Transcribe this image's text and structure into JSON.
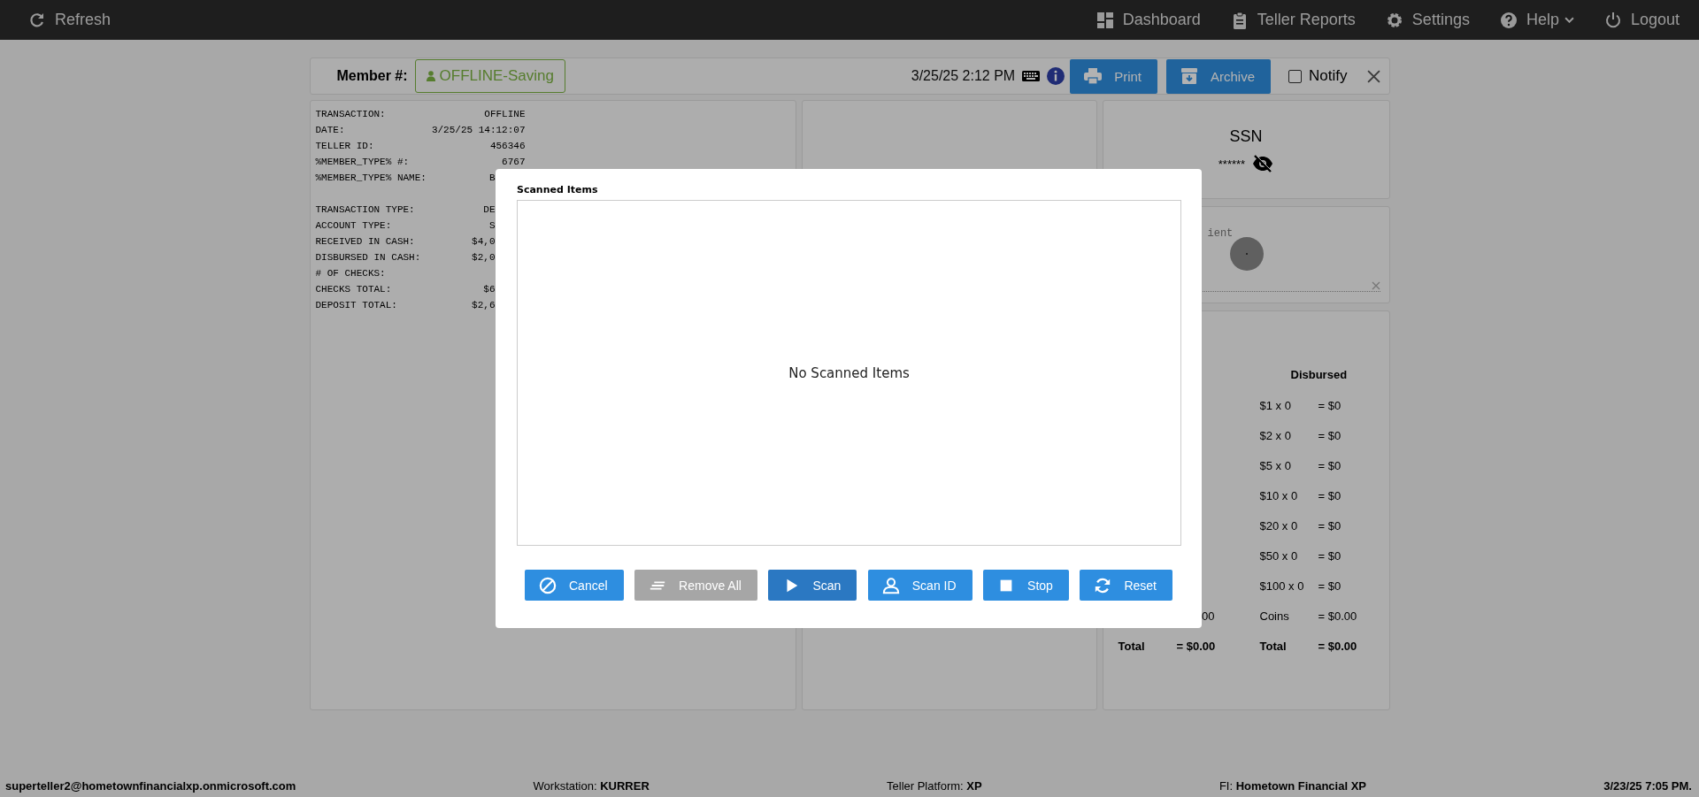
{
  "topbar": {
    "refresh": "Refresh",
    "nav": [
      {
        "label": "Dashboard",
        "dropdown": false
      },
      {
        "label": "Teller Reports",
        "dropdown": false
      },
      {
        "label": "Settings",
        "dropdown": false
      },
      {
        "label": "Help",
        "dropdown": true
      },
      {
        "label": "Logout",
        "dropdown": false
      }
    ]
  },
  "header": {
    "member_label": "Member #:",
    "member_badge": "OFFLINE-Saving",
    "datetime": "3/25/25 2:12 PM",
    "buttons": [
      "Print",
      "Archive"
    ],
    "notify": {
      "label": "Notify",
      "checked": false
    }
  },
  "receipt": {
    "sections": [
      [
        {
          "label": "TRANSACTION:",
          "value": "OFFLINE",
          "cut": false
        },
        {
          "label": "DATE:",
          "value": "3/25/25 14:12:07",
          "cut": false
        },
        {
          "label": "TELLER ID:",
          "value": "456346",
          "cut": false
        },
        {
          "label": "%MEMBER_TYPE% #:",
          "value": "6767",
          "cut": false
        },
        {
          "label": "%MEMBER_TYPE% NAME:",
          "value": "B",
          "cut": true
        }
      ],
      [
        {
          "label": "TRANSACTION TYPE:",
          "value": "DE",
          "cut": true
        },
        {
          "label": "ACCOUNT TYPE:",
          "value": "S",
          "cut": true
        },
        {
          "label": "RECEIVED IN CASH:",
          "value": "$4,0",
          "cut": true
        },
        {
          "label": "DISBURSED IN CASH:",
          "value": "$2,0",
          "cut": true
        },
        {
          "label": "# OF CHECKS:"
        },
        {
          "label": "CHECKS TOTAL:",
          "value": "$6",
          "cut": true
        },
        {
          "label": "DEPOSIT TOTAL:",
          "value": "$2,6",
          "cut": true
        }
      ]
    ]
  },
  "ssn": {
    "title": "SSN",
    "value": "******",
    "hidden": true
  },
  "signature": {
    "label": "ient"
  },
  "cash": {
    "heading": "Disbursed",
    "rows": [
      {
        "kind": "count",
        "label": "$1 x 0",
        "amount": "= $0"
      },
      {
        "kind": "count",
        "label": "$2 x 0",
        "amount": "= $0"
      },
      {
        "kind": "count",
        "label": "$5 x 0",
        "amount": "= $0"
      },
      {
        "kind": "count",
        "label": "$10 x 0",
        "amount": "= $0"
      },
      {
        "kind": "count",
        "label": "$20 x 0",
        "amount": "= $0"
      },
      {
        "kind": "count",
        "label": "$50 x 0",
        "amount": "= $0"
      },
      {
        "kind": "count",
        "label": "$100 x 0",
        "amount": "= $0"
      },
      {
        "kind": "coins",
        "left_amount": "00",
        "label": "Coins",
        "amount": "= $0.00"
      },
      {
        "kind": "total",
        "left_label": "Total",
        "left_amount": "= $0.00",
        "label": "Total",
        "amount": "= $0.00"
      }
    ]
  },
  "modal": {
    "title": "Scanned Items",
    "empty_text": "No Scanned Items",
    "buttons": [
      {
        "label": "Cancel",
        "disabled": false,
        "pressed": false
      },
      {
        "label": "Remove All",
        "disabled": true,
        "pressed": false
      },
      {
        "label": "Scan",
        "disabled": false,
        "pressed": true
      },
      {
        "label": "Scan ID",
        "disabled": false,
        "pressed": false
      },
      {
        "label": "Stop",
        "disabled": false,
        "pressed": false
      },
      {
        "label": "Reset",
        "disabled": false,
        "pressed": false
      }
    ]
  },
  "status_bar": {
    "user": "superteller2@hometownfinancialxp.onmicrosoft.com",
    "items": [
      {
        "label": "Workstation:",
        "value": "KURRER"
      },
      {
        "label": "Teller Platform:",
        "value": "XP"
      },
      {
        "label": "FI:",
        "value": "Hometown Financial XP"
      }
    ],
    "datetime": "3/23/25 7:05 PM."
  }
}
